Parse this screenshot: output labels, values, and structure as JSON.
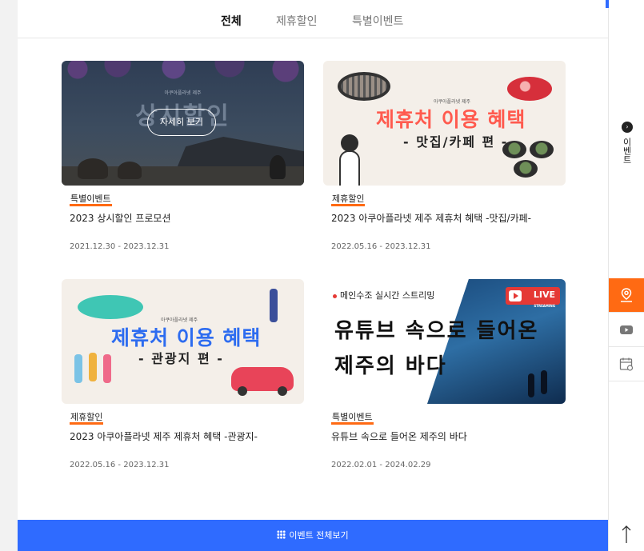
{
  "tabs": [
    {
      "label": "전체",
      "active": true
    },
    {
      "label": "제휴할인",
      "active": false
    },
    {
      "label": "특별이벤트",
      "active": false
    }
  ],
  "cards": [
    {
      "category": "특별이벤트",
      "title": "2023 상시할인 프로모션",
      "dates": "2021.12.30 - 2023.12.31",
      "image": {
        "small": "아쿠아플라넷 제주",
        "big": "상시할인",
        "button": "자세히 보기"
      }
    },
    {
      "category": "제휴할인",
      "title": "2023 아쿠아플라넷 제주 제휴처 혜택 -맛집/카페-",
      "dates": "2022.05.16 - 2023.12.31",
      "image": {
        "small": "아쿠아플라넷 제주",
        "main": "제휴처 이용 혜택",
        "line": "- 맛집/카페 편 -"
      }
    },
    {
      "category": "제휴할인",
      "title": "2023 아쿠아플라넷 제주 제휴처 혜택 -관광지-",
      "dates": "2022.05.16 - 2023.12.31",
      "image": {
        "small": "아쿠아플라넷 제주",
        "main": "제휴처 이용 혜택",
        "line": "- 관광지 편 -"
      }
    },
    {
      "category": "특별이벤트",
      "title": "유튜브 속으로 들어온 제주의 바다",
      "dates": "2022.02.01 - 2024.02.29",
      "image": {
        "badge": "메인수조 실시간 스트리밍",
        "line1": "유튜브 속으로 들어온",
        "line2": "제주의 바다",
        "live": "LIVE",
        "streaming": "STREAMING"
      }
    }
  ],
  "footer": {
    "all_events_label": "이벤트 전체보기"
  },
  "rail": {
    "event_tab_label": "이벤트"
  },
  "colors": {
    "accent_blue": "#2f6bff",
    "accent_orange": "#ff6a13"
  },
  "icons": [
    "grid-icon",
    "map-pin-icon",
    "youtube-icon",
    "calendar-icon",
    "arrow-up-icon",
    "chevron-right-icon"
  ]
}
